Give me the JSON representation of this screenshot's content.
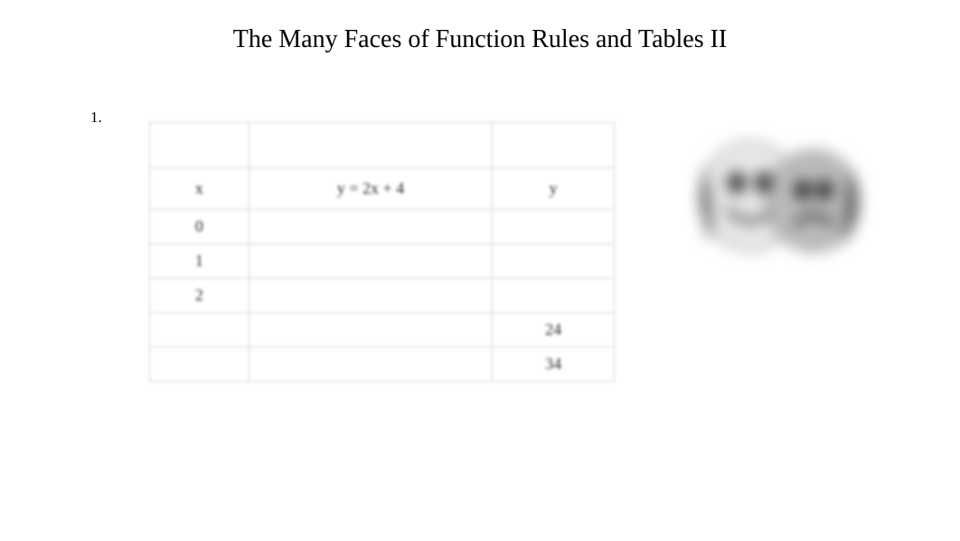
{
  "title": "The Many Faces of Function Rules and Tables II",
  "problem_number": "1.",
  "table": {
    "header": {
      "x": "x",
      "rule": "y = 2x +  4",
      "y": "y"
    },
    "rows": [
      {
        "x": "0",
        "rule": "",
        "y": ""
      },
      {
        "x": "1",
        "rule": "",
        "y": ""
      },
      {
        "x": "2",
        "rule": "",
        "y": ""
      },
      {
        "x": "",
        "rule": "",
        "y": "24"
      },
      {
        "x": "",
        "rule": "",
        "y": "34"
      }
    ]
  }
}
